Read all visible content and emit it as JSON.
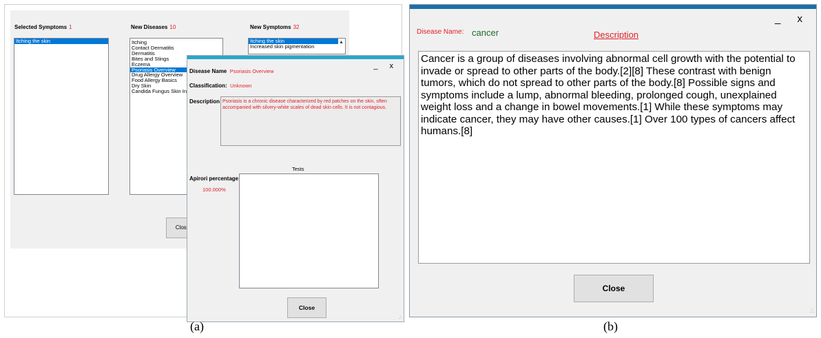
{
  "panel_a": {
    "main_form": {
      "selected_symptoms": {
        "label": "Selected Symptoms",
        "count": "1",
        "items": [
          "Itching the skin"
        ]
      },
      "new_diseases": {
        "label": "New Diseases",
        "count": "10",
        "items": [
          "Itching",
          "Contact Dermatitis",
          "Dermatitis",
          "Bites and Stings",
          "Eczema",
          "Psoriasis Overview",
          "Drug Allergy Overview",
          "Food Allergy Basics",
          "Dry Skin",
          "Candida Fungus Skin Infection"
        ],
        "selected_index": 5
      },
      "new_symptoms": {
        "label": "New Symptoms",
        "count": "32",
        "items": [
          "Itching the skin",
          "Increased skin pigmentation"
        ]
      },
      "close_label": "Close"
    },
    "overlay": {
      "win_controls": "_ x",
      "disease_name_label": "Disease Name",
      "disease_name_value": "Psoriasis Overview",
      "classification_label": "Classification:",
      "classification_value": "Unknown",
      "description_label": "Description",
      "description_value": "Psoriasis is a chronic disease characterized by red patches on the skin, often accompanied with silvery-white scales of dead skin cells. It is not contagious.",
      "tests_label": "Tests",
      "apriori_label": "Apirori percentage",
      "apriori_value": "100.000%",
      "close_label": "Close"
    },
    "caption": "(a)"
  },
  "panel_b": {
    "win_controls": "_ x",
    "disease_name_label": "Disease Name:",
    "disease_name_value": "cancer",
    "description_title": "Description",
    "description_text": "Cancer is a group of diseases involving abnormal cell growth with the potential to invade or spread to other parts of the body.[2][8] These contrast with benign tumors, which do not spread to other parts of the body.[8] Possible signs and symptoms include a lump, abnormal bleeding, prolonged cough, unexplained weight loss and a change in bowel movements.[1] While these symptoms may indicate cancer, they may have other causes.[1] Over 100 types of cancers affect humans.[8]",
    "close_label": "Close",
    "caption": "(b)"
  },
  "colors": {
    "accent_red": "#e0202a",
    "selection_blue": "#0078d7",
    "value_green": "#1f6d2a",
    "title_bar_blue": "#1c6fa8"
  },
  "icons": [
    "scroll-up-arrow-icon",
    "resize-grip-icon"
  ]
}
